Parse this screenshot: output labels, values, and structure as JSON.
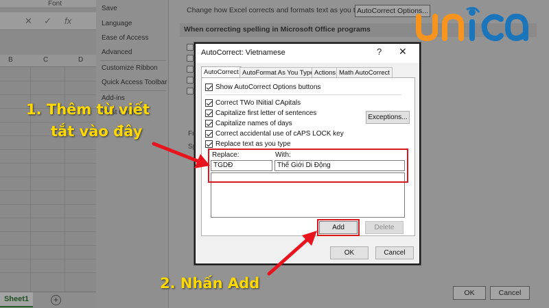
{
  "excel": {
    "ribbon_group": "Font",
    "formula_bar_buttons": [
      "✕",
      "✓",
      "fx"
    ],
    "column_headers": [
      "B",
      "C",
      "D"
    ],
    "sheet_tab": "Sheet1",
    "add_sheet": "+"
  },
  "options": {
    "nav_items": [
      "Save",
      "Language",
      "Ease of Access",
      "Advanced",
      "Customize Ribbon",
      "Quick Access Toolbar",
      "Add-ins",
      "Trust Center"
    ],
    "proofing_description": "Change how Excel corrects and formats text as you type:",
    "autocorrect_options_button": "AutoCorrect Options...",
    "section_header": "When correcting spelling in Microsoft Office programs",
    "fragment_fr": "Fr",
    "fragment_sp": "Sp",
    "ok": "OK",
    "cancel": "Cancel"
  },
  "dialog": {
    "title": "AutoCorrect: Vietnamese",
    "help": "?",
    "close": "✕",
    "tabs": [
      "AutoCorrect",
      "AutoFormat As You Type",
      "Actions",
      "Math AutoCorrect"
    ],
    "show_buttons": "Show AutoCorrect Options buttons",
    "options": [
      "Correct TWo INitial CApitals",
      "Capitalize first letter of sentences",
      "Capitalize names of days",
      "Correct accidental use of cAPS LOCK key",
      "Replace text as you type"
    ],
    "exceptions_button": "Exceptions...",
    "replace_label": "Replace:",
    "with_label": "With:",
    "replace_value": "TGDĐ",
    "with_value": "Thế Giới Di Động",
    "add_button": "Add",
    "delete_button": "Delete",
    "ok_button": "OK",
    "cancel_button": "Cancel"
  },
  "annotations": {
    "step1_line1": "1. Thêm từ viết",
    "step1_line2": "tắt vào đây",
    "step2": "2. Nhấn Add",
    "color": "#ffd800",
    "arrow_color": "#e8141d"
  },
  "logo": {
    "text": "unica",
    "color_orange": "#f7941d",
    "color_blue": "#1b75bb"
  }
}
